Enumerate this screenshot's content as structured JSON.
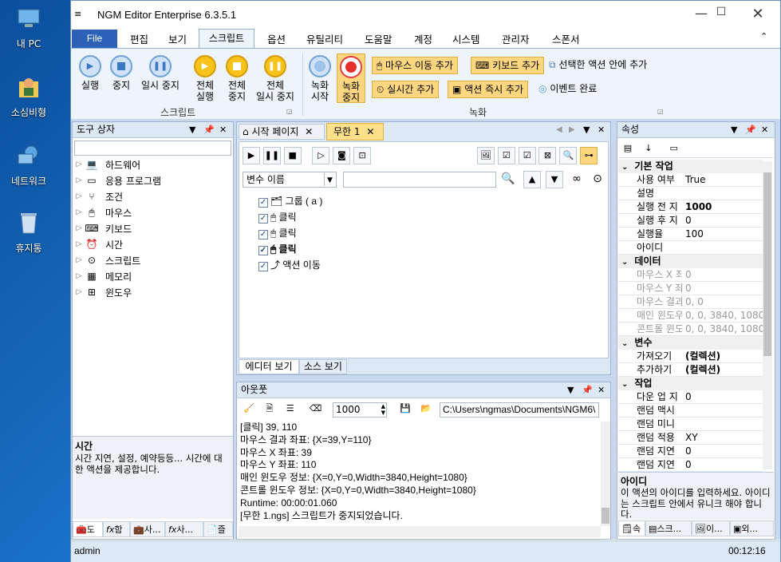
{
  "desktop": {
    "icons": [
      {
        "label": "내 PC",
        "icon": "computer-icon"
      },
      {
        "label": "소심비형",
        "icon": "user-folder-icon"
      },
      {
        "label": "네트워크",
        "icon": "network-icon"
      },
      {
        "label": "휴지통",
        "icon": "recycle-bin-icon"
      }
    ]
  },
  "window": {
    "title": "NGM Editor    Enterprise 6.3.5.1"
  },
  "menu": {
    "file": "File",
    "items": [
      "편집",
      "보기",
      "스크립트",
      "옵션",
      "유틸리티",
      "도움말",
      "계정",
      "시스템",
      "관리자",
      "스폰서"
    ]
  },
  "ribbon": {
    "script_group": "스크립트",
    "record_group": "녹화",
    "buttons": {
      "run": "실행",
      "stop": "중지",
      "pause": "일시 중지",
      "all_run_1": "전체",
      "all_run_2": "실행",
      "all_stop_1": "전체",
      "all_stop_2": "중지",
      "all_pause_1": "전체",
      "all_pause_2": "일시 중지",
      "rec_start_1": "녹화",
      "rec_start_2": "시작",
      "rec_stop_1": "녹화",
      "rec_stop_2": "중지"
    },
    "record": {
      "mouse_move": "마우스 이동 추가",
      "keyboard": "키보드 추가",
      "inside_selected": "선택한 액션 안에 추가",
      "realtime": "실시간 추가",
      "instant": "액션 즉시 추가",
      "event_done": "이벤트 완료"
    }
  },
  "toolbox": {
    "title": "도구 상자",
    "items": [
      "하드웨어",
      "응용 프로그램",
      "조건",
      "마우스",
      "키보드",
      "시간",
      "스크립트",
      "메모리",
      "윈도우"
    ],
    "desc_title": "시간",
    "desc_text": "시간 지연, 설정, 예약등등... 시간에 대한 액션을 제공합니다.",
    "bottom_tabs": [
      "도",
      "함",
      "사...",
      "사...",
      "즐"
    ]
  },
  "editor": {
    "tabs": [
      "시작 페이지",
      "무한 1"
    ],
    "var_dropdown": "변수 이름",
    "search_placeholder": "",
    "actions": [
      {
        "label": "그룹 ( a )",
        "icon": "group-icon"
      },
      {
        "label": "클릭",
        "icon": "mouse-click-icon"
      },
      {
        "label": "클릭",
        "icon": "mouse-click-icon"
      },
      {
        "label": "클릭",
        "icon": "mouse-click-icon"
      },
      {
        "label": "액션 이동",
        "icon": "action-move-icon"
      }
    ],
    "view_tabs": [
      "에디터 보기",
      "소스 보기"
    ]
  },
  "output": {
    "title": "아웃풋",
    "speed": "1000",
    "path": "C:\\Users\\ngmas\\Documents\\NGM6\\",
    "lines": [
      "[클릭] 39, 110",
      "마우스 결과 좌표: {X=39,Y=110}",
      "마우스 X 좌표: 39",
      "마우스 Y 좌표: 110",
      "매인 윈도우 정보: {X=0,Y=0,Width=3840,Height=1080}",
      "콘트롤 윈도우 정보: {X=0,Y=0,Width=3840,Height=1080}",
      "Runtime: 00:00:01.060",
      "[무한 1.ngs] 스크립트가 중지되었습니다."
    ]
  },
  "properties": {
    "title": "속성",
    "sections": [
      {
        "name": "기본 작업",
        "rows": [
          [
            "사용 여부",
            "True"
          ],
          [
            "설명",
            ""
          ],
          [
            "실행 전 지",
            "1000"
          ],
          [
            "실행 후 지",
            "0"
          ],
          [
            "실행율",
            "100"
          ],
          [
            "아이디",
            ""
          ]
        ]
      },
      {
        "name": "데이터",
        "rows": [
          [
            "마우스 X 좌",
            "0"
          ],
          [
            "마우스 Y 좌",
            "0"
          ],
          [
            "마우스 결과",
            "0, 0"
          ],
          [
            "매인 윈도우",
            "0, 0, 3840, 1080"
          ],
          [
            "콘트롤 윈도",
            "0, 0, 3840, 1080"
          ]
        ]
      },
      {
        "name": "변수",
        "rows": [
          [
            "가져오기",
            "(컬렉션)"
          ],
          [
            "추가하기",
            "(컬렉션)"
          ]
        ]
      },
      {
        "name": "작업",
        "rows": [
          [
            "다운 업 지",
            "0"
          ],
          [
            "랜덤 맥시",
            "",
            ""
          ],
          [
            "랜덤 미니",
            "",
            ""
          ],
          [
            "랜덤 적용",
            "XY"
          ],
          [
            "랜덤 지연",
            "0"
          ],
          [
            "랜덤 지연",
            "0"
          ]
        ]
      }
    ],
    "desc_title": "아이디",
    "desc_text": "이 액션의 아이디를 입력하세요. 아이디는 스크립트 안에서 유니크 해야 합니다.",
    "bottom_tabs": [
      "속",
      "스크...",
      "이...",
      "외..."
    ]
  },
  "status": {
    "user": "admin",
    "time": "00:12:16"
  }
}
